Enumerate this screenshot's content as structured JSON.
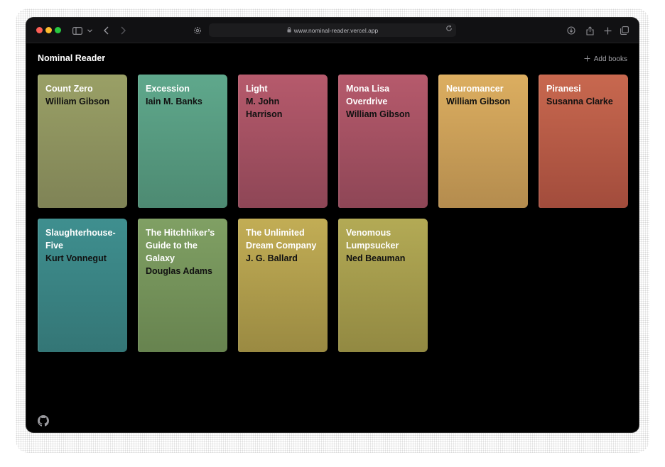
{
  "browser": {
    "url": "www.nominal-reader.vercel.app",
    "icons": [
      "sidebar-icon",
      "chevron-down-icon",
      "back-icon",
      "forward-icon",
      "settings-icon",
      "lock-icon",
      "reload-icon",
      "download-icon",
      "share-icon",
      "new-tab-icon",
      "tabs-overview-icon"
    ]
  },
  "app": {
    "title": "Nominal Reader",
    "add_books_label": "Add books"
  },
  "books": [
    {
      "title": "Count Zero",
      "author": "William Gibson",
      "color_top": "#9aa066",
      "color_bottom": "#7f8356"
    },
    {
      "title": "Excession",
      "author": "Iain M. Banks",
      "color_top": "#5fa88c",
      "color_bottom": "#4d8a72"
    },
    {
      "title": "Light",
      "author": "M. John Harrison",
      "color_top": "#b65a6c",
      "color_bottom": "#8e4656"
    },
    {
      "title": "Mona Lisa Overdrive",
      "author": "William Gibson",
      "color_top": "#b65a6c",
      "color_bottom": "#8e4656"
    },
    {
      "title": "Neuromancer",
      "author": "William Gibson",
      "color_top": "#dcae60",
      "color_bottom": "#b48c4e"
    },
    {
      "title": "Piranesi",
      "author": "Susanna Clarke",
      "color_top": "#c8684f",
      "color_bottom": "#a24c3c"
    },
    {
      "title": "Slaughterhouse-Five",
      "author": "Kurt Vonnegut",
      "color_top": "#3f8f8f",
      "color_bottom": "#347676"
    },
    {
      "title": "The Hitchhiker’s Guide to the Galaxy",
      "author": "Douglas Adams",
      "color_top": "#80a064",
      "color_bottom": "#67834f"
    },
    {
      "title": "The Unlimited Dream Company",
      "author": "J. G. Ballard",
      "color_top": "#c2ad55",
      "color_bottom": "#9a8a42"
    },
    {
      "title": "Venomous Lumpsucker",
      "author": "Ned Beauman",
      "color_top": "#b3aa55",
      "color_bottom": "#928942"
    }
  ],
  "footer": {
    "icon": "github-icon"
  }
}
